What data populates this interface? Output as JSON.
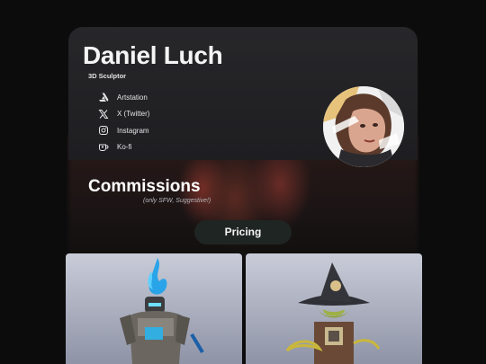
{
  "profile": {
    "name": "Daniel Luch",
    "role": "3D Sculptor"
  },
  "links": [
    {
      "label": "Artstation",
      "icon": "artstation-icon"
    },
    {
      "label": "X (Twitter)",
      "icon": "x-twitter-icon"
    },
    {
      "label": "Instagram",
      "icon": "instagram-icon"
    },
    {
      "label": "Ko-fi",
      "icon": "kofi-icon"
    }
  ],
  "commissions": {
    "title": "Commissions",
    "note": "(only SFW, Suggestive!)",
    "pricing_label": "Pricing"
  },
  "gallery": [
    {
      "image": "armored-knight-blue-flame-sculpt"
    },
    {
      "image": "witch-goblin-sculpt"
    }
  ],
  "colors": {
    "background": "#0c0c0d",
    "card": "#27272a",
    "button": "#1f2523",
    "text": "#ffffff"
  }
}
